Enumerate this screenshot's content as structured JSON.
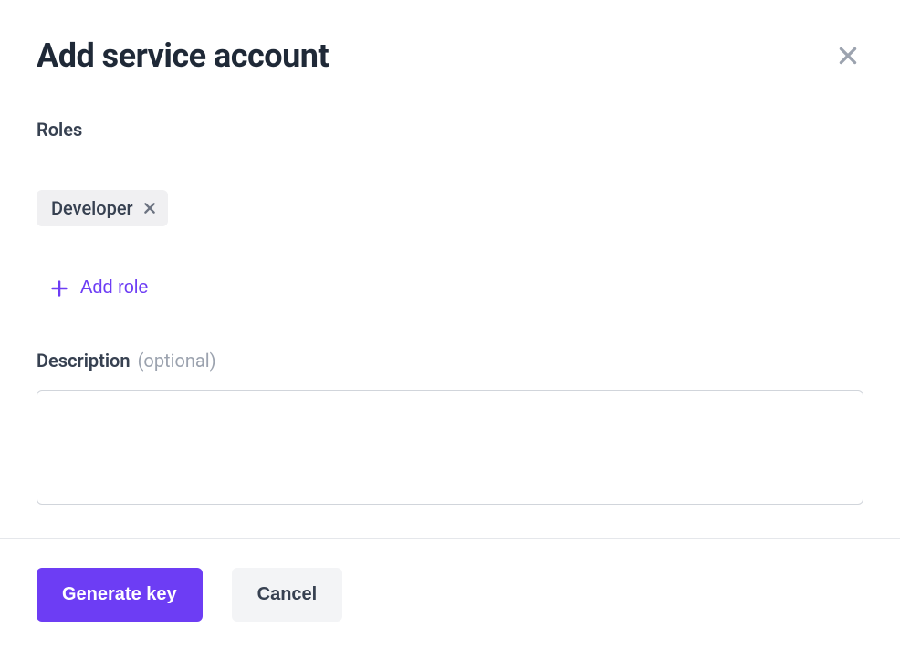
{
  "modal": {
    "title": "Add service account",
    "roles_label": "Roles",
    "roles": [
      {
        "label": "Developer"
      }
    ],
    "add_role_label": "Add role",
    "description_label": "Description",
    "description_optional": "(optional)",
    "description_value": "",
    "footer": {
      "primary": "Generate key",
      "secondary": "Cancel"
    }
  },
  "colors": {
    "accent": "#6d3df4",
    "text_primary": "#1f2937",
    "text_secondary": "#374151",
    "text_muted": "#9ca3af",
    "chip_bg": "#f0f0f2",
    "border": "#d1d5db",
    "divider": "#e5e7eb",
    "btn_secondary_bg": "#f3f4f6"
  }
}
